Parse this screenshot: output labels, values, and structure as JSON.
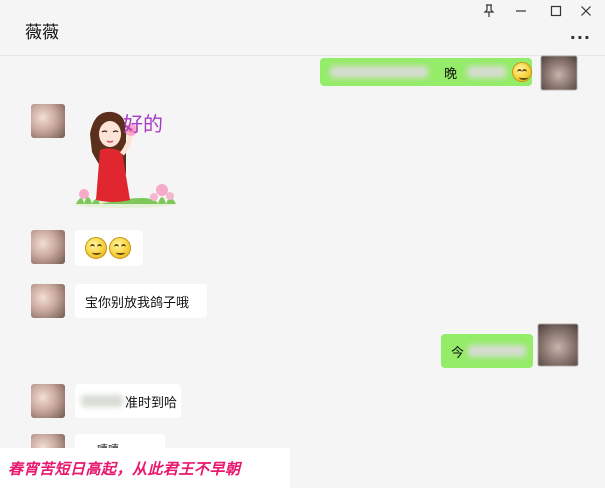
{
  "window": {
    "title": "薇薇",
    "more_glyph": "···"
  },
  "messages": [
    {
      "side": "me",
      "text_visible": "晚",
      "emoji": "laughing-tears-emoji"
    },
    {
      "side": "other",
      "sticker_caption": "好的"
    },
    {
      "side": "other",
      "emoji_count": 2
    },
    {
      "side": "other",
      "text": "宝你别放我鸽子哦"
    },
    {
      "side": "me",
      "text_visible": "今"
    },
    {
      "side": "other",
      "text_visible": "准时到哈"
    },
    {
      "side": "other",
      "text_visible": "嘻嘻"
    }
  ],
  "footer": {
    "caption": "春宵苦短日高起，从此君王不早朝"
  },
  "colors": {
    "bubble_me": "#95ec69",
    "bubble_other": "#ffffff",
    "background": "#f5f5f5",
    "caption": "#e8186f"
  }
}
